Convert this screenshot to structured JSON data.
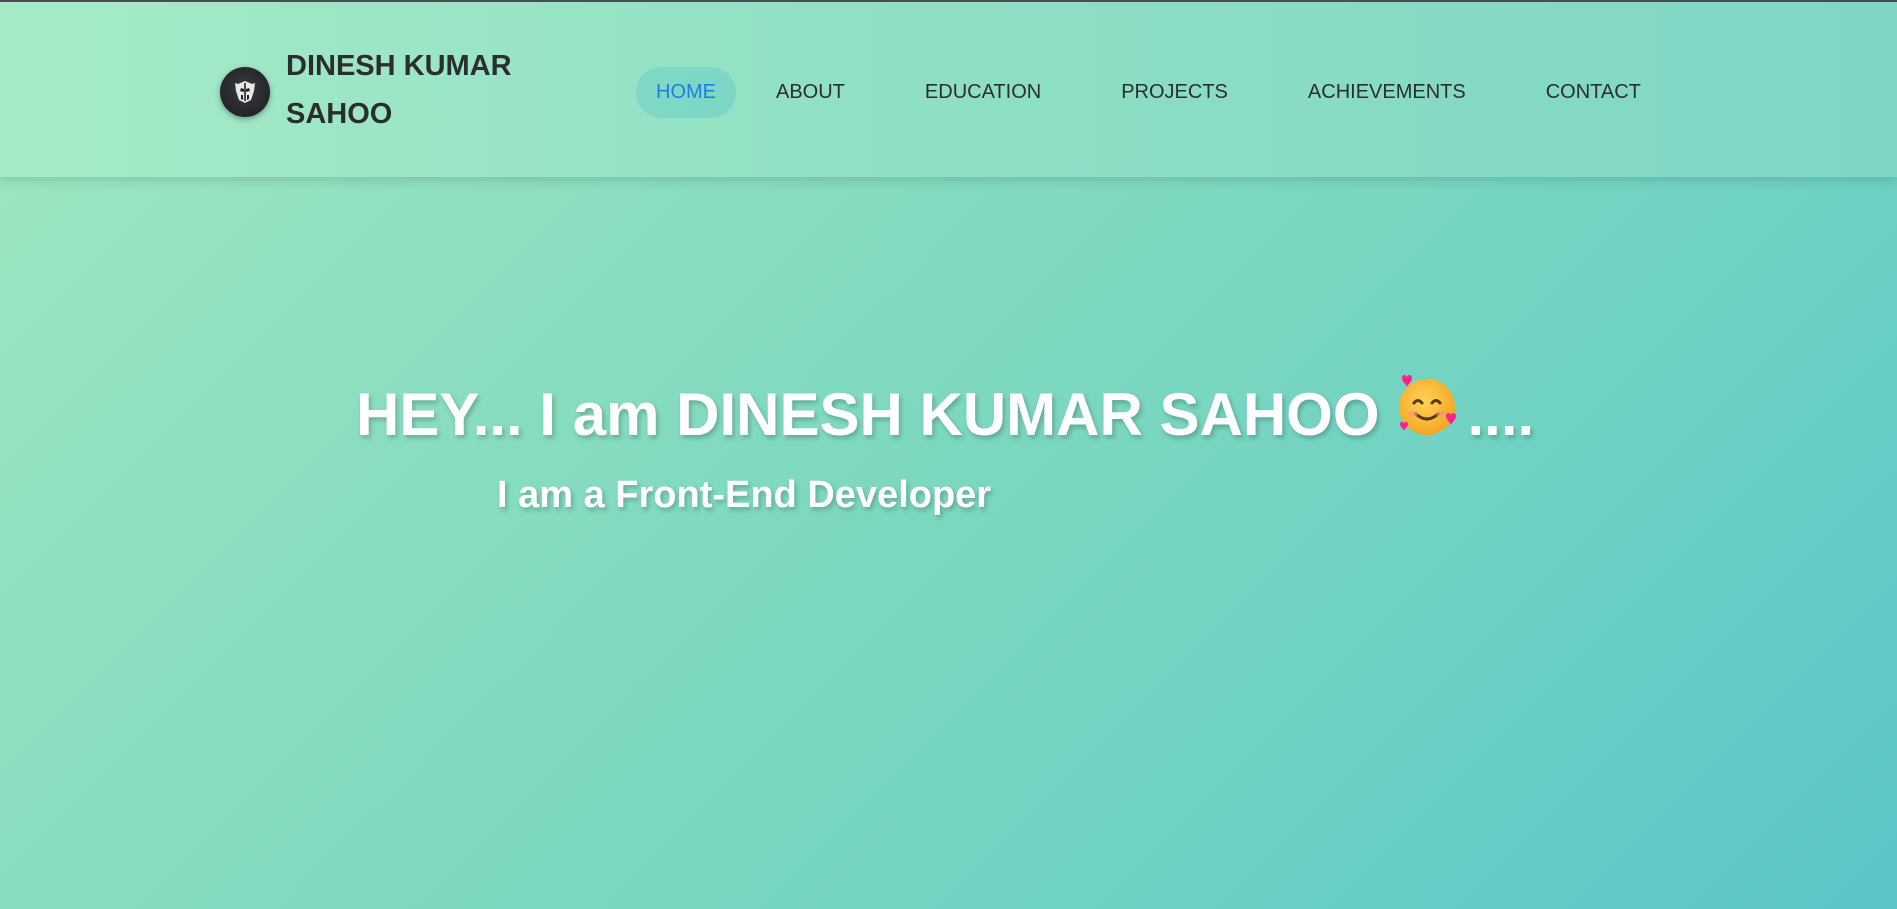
{
  "header": {
    "brand_name": "DINESH KUMAR SAHOO",
    "logo_icon": "autobot-logo-icon",
    "nav": [
      {
        "label": "HOME",
        "active": true
      },
      {
        "label": "ABOUT",
        "active": false
      },
      {
        "label": "EDUCATION",
        "active": false
      },
      {
        "label": "PROJECTS",
        "active": false
      },
      {
        "label": "ACHIEVEMENTS",
        "active": false
      },
      {
        "label": "CONTACT",
        "active": false
      }
    ]
  },
  "hero": {
    "title_text": "HEY... I am DINESH KUMAR SAHOO",
    "title_emoji": "smiling-face-with-hearts-icon",
    "title_trailing": "....",
    "subtitle": "I am a Front-End Developer"
  },
  "colors": {
    "nav_active": "#1b7fe0",
    "text_dark": "#2b2e2f",
    "hero_text": "#ffffff",
    "bg_start": "#9ee8c0",
    "bg_end": "#5ac4c8"
  }
}
